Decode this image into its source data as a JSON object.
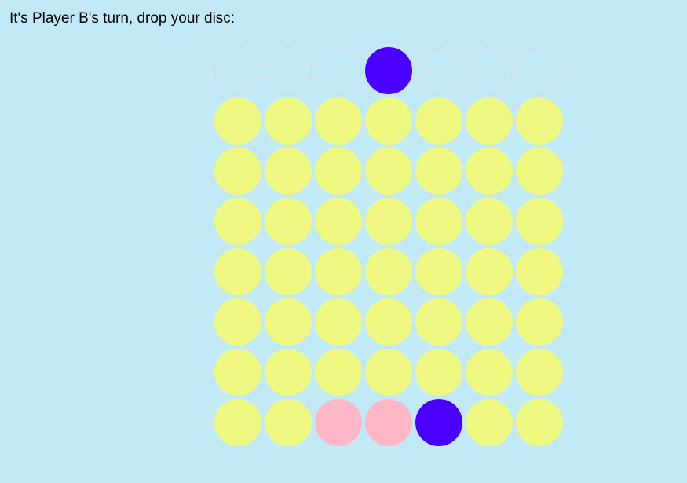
{
  "status_text": "It's Player B's turn, drop your disc:",
  "current_player": "B",
  "selected_column": 3,
  "columns": 7,
  "rows": 7,
  "colors": {
    "background": "#c2eaf6",
    "empty": "#eef780",
    "player_a": "#ffb6c6",
    "player_b": "#4a00ff",
    "selector_outline": "#d3d9dc"
  },
  "board": [
    [
      "empty",
      "empty",
      "empty",
      "empty",
      "empty",
      "empty",
      "empty"
    ],
    [
      "empty",
      "empty",
      "empty",
      "empty",
      "empty",
      "empty",
      "empty"
    ],
    [
      "empty",
      "empty",
      "empty",
      "empty",
      "empty",
      "empty",
      "empty"
    ],
    [
      "empty",
      "empty",
      "empty",
      "empty",
      "empty",
      "empty",
      "empty"
    ],
    [
      "empty",
      "empty",
      "empty",
      "empty",
      "empty",
      "empty",
      "empty"
    ],
    [
      "empty",
      "empty",
      "empty",
      "empty",
      "empty",
      "empty",
      "empty"
    ],
    [
      "empty",
      "empty",
      "A",
      "A",
      "B",
      "empty",
      "empty"
    ]
  ]
}
